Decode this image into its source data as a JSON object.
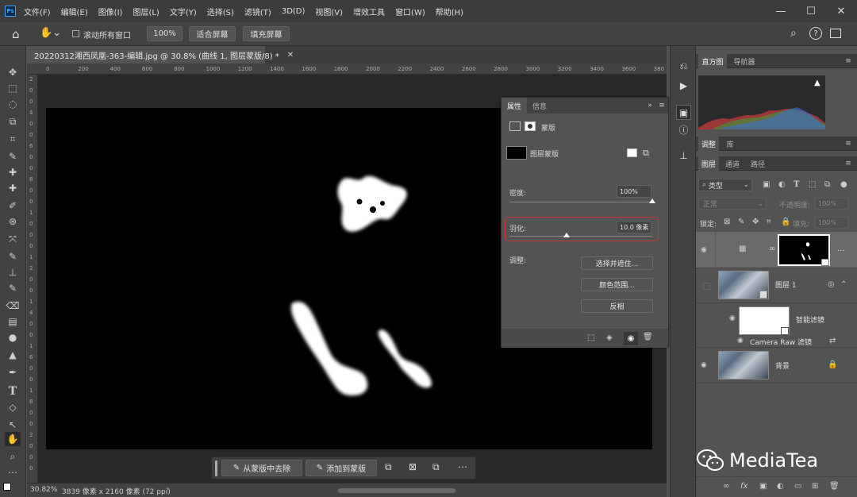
{
  "app": {
    "logo": "Ps",
    "menu": [
      "文件(F)",
      "编辑(E)",
      "图像(I)",
      "图层(L)",
      "文字(Y)",
      "选择(S)",
      "滤镜(T)",
      "3D(D)",
      "视图(V)",
      "增效工具",
      "窗口(W)",
      "帮助(H)"
    ],
    "window_controls": [
      "minimize-icon",
      "maximize-icon",
      "close-icon"
    ]
  },
  "options_bar": {
    "scroll_all_label": "滚动所有窗口",
    "zoom_value": "100%",
    "fit_screen_label": "适合屏幕",
    "fill_screen_label": "填充屏幕"
  },
  "document": {
    "tab_title": "20220312湘西凤凰-363-编辑.jpg @ 30.8% (曲线 1, 图层蒙版/8) *",
    "ruler_ticks": [
      "0",
      "200",
      "400",
      "600",
      "800",
      "1000",
      "1200",
      "1400",
      "1600",
      "1800",
      "2000",
      "2200",
      "2400",
      "2600",
      "2800",
      "3000",
      "3200",
      "3400",
      "3600",
      "380"
    ],
    "ruler_v_ticks": [
      "2",
      "0",
      "0",
      "4",
      "0",
      "0",
      "6",
      "0",
      "0",
      "8",
      "0",
      "0",
      "1",
      "0",
      "0",
      "0",
      "1",
      "2",
      "0",
      "0",
      "1",
      "4",
      "0",
      "0",
      "1",
      "6",
      "0",
      "0",
      "1",
      "8",
      "0",
      "0",
      "2",
      "0",
      "0",
      "0"
    ],
    "zoom": "30.82%",
    "info": "3839 像素 x 2160 像素 (72 ppi)"
  },
  "task_bar": {
    "subtract_label": "从蒙版中去除",
    "add_label": "添加到蒙版"
  },
  "properties": {
    "tab_properties": "属性",
    "tab_info": "信息",
    "mask_type": "蒙版",
    "layer_mask_label": "图层蒙版",
    "density_label": "密度:",
    "density_value": "100%",
    "density_pct": 100,
    "feather_label": "羽化:",
    "feather_value": "10.0 像素",
    "adjust_label": "调整:",
    "select_mask_btn": "选择并遮住...",
    "color_range_btn": "颜色范围...",
    "invert_btn": "反相",
    "highlight_color": "#d03030"
  },
  "right_panels": {
    "histogram_tab": "直方图",
    "navigator_tab": "导航器",
    "adjust_tab": "调整",
    "library_tab": "库",
    "layers_tab": "图层",
    "channels_tab": "通道",
    "paths_tab": "路径",
    "kind_filter": "类型",
    "blend_mode": "正常",
    "opacity_label": "不透明度:",
    "opacity_value": "100%",
    "lock_label": "锁定:",
    "fill_label": "填充:",
    "fill_value": "100%",
    "layers": [
      {
        "name": "图层 1"
      },
      {
        "name": "智能滤镜"
      },
      {
        "name": "Camera Raw 滤镜"
      },
      {
        "name": "背景"
      }
    ]
  },
  "watermark": "MediaTea"
}
